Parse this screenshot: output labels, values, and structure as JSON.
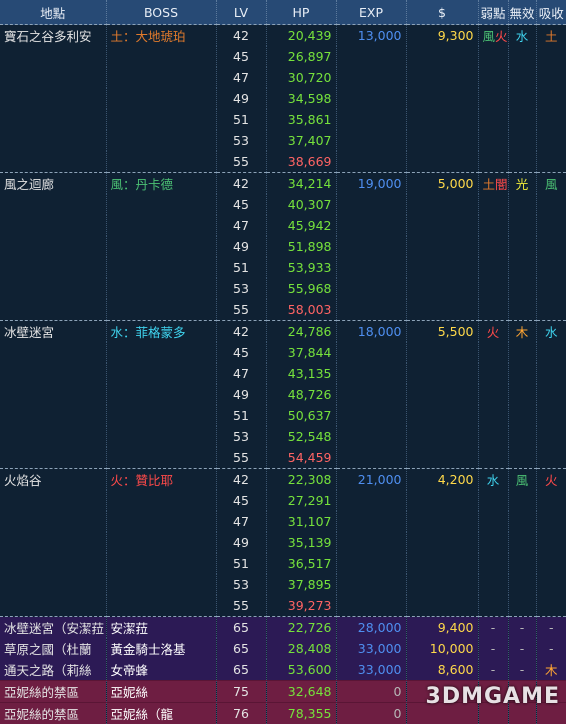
{
  "headers": [
    "地點",
    "BOSS",
    "LV",
    "HP",
    "EXP",
    "$",
    "弱點",
    "無效",
    "吸收"
  ],
  "colors": {
    "hp_green": "#76e23c",
    "hp_red": "#ff6464",
    "exp_blue": "#4f8ff0",
    "gold_yellow": "#ffd94a",
    "earth_orange": "#e07a2c",
    "wind_green": "#4cc274",
    "water_cyan": "#3fd3ee",
    "fire_red": "#ff4a4a",
    "light_yellow": "#f2ee3a",
    "wood_orange": "#ffa533",
    "earthdark_orange": "#e07a2c",
    "dash_gray": "#b7b7b7",
    "white": "#ffffff",
    "plain": "#e4e4e4"
  },
  "rows": [
    {
      "loc": "寶石之谷多利安",
      "boss": "土：大地琥珀",
      "boss_color": "earth_orange",
      "lv": "42",
      "hp": "20,439",
      "hp_color": "hp_green",
      "exp": "13,000",
      "gold": "9,300",
      "weak": "風火",
      "weak_colors": [
        "wind_green",
        "fire_red"
      ],
      "null": "水",
      "null_color": "water_cyan",
      "absorb": "土",
      "absorb_color": "earth_orange",
      "theme": "dark",
      "start": true
    },
    {
      "lv": "45",
      "hp": "26,897",
      "hp_color": "hp_green",
      "theme": "dark"
    },
    {
      "lv": "47",
      "hp": "30,720",
      "hp_color": "hp_green",
      "theme": "dark"
    },
    {
      "lv": "49",
      "hp": "34,598",
      "hp_color": "hp_green",
      "theme": "dark"
    },
    {
      "lv": "51",
      "hp": "35,861",
      "hp_color": "hp_green",
      "theme": "dark"
    },
    {
      "lv": "53",
      "hp": "37,407",
      "hp_color": "hp_green",
      "theme": "dark"
    },
    {
      "lv": "55",
      "hp": "38,669",
      "hp_color": "hp_red",
      "theme": "dark"
    },
    {
      "loc": "風之迴廊",
      "boss": "風：丹卡德",
      "boss_color": "wind_green",
      "lv": "42",
      "hp": "34,214",
      "hp_color": "hp_green",
      "exp": "19,000",
      "gold": "5,000",
      "weak": "土闇",
      "weak_colors": [
        "earth_orange",
        "fire_red"
      ],
      "null": "光",
      "null_color": "light_yellow",
      "absorb": "風",
      "absorb_color": "wind_green",
      "theme": "dark",
      "start": true
    },
    {
      "lv": "45",
      "hp": "40,307",
      "hp_color": "hp_green",
      "theme": "dark"
    },
    {
      "lv": "47",
      "hp": "45,942",
      "hp_color": "hp_green",
      "theme": "dark"
    },
    {
      "lv": "49",
      "hp": "51,898",
      "hp_color": "hp_green",
      "theme": "dark"
    },
    {
      "lv": "51",
      "hp": "53,933",
      "hp_color": "hp_green",
      "theme": "dark"
    },
    {
      "lv": "53",
      "hp": "55,968",
      "hp_color": "hp_green",
      "theme": "dark"
    },
    {
      "lv": "55",
      "hp": "58,003",
      "hp_color": "hp_red",
      "theme": "dark"
    },
    {
      "loc": "冰壁迷宮",
      "boss": "水：菲格蒙多",
      "boss_color": "water_cyan",
      "lv": "42",
      "hp": "24,786",
      "hp_color": "hp_green",
      "exp": "18,000",
      "gold": "5,500",
      "weak": "火",
      "weak_colors": [
        "fire_red"
      ],
      "null": "木",
      "null_color": "wood_orange",
      "absorb": "水",
      "absorb_color": "water_cyan",
      "theme": "dark",
      "start": true
    },
    {
      "lv": "45",
      "hp": "37,844",
      "hp_color": "hp_green",
      "theme": "dark"
    },
    {
      "lv": "47",
      "hp": "43,135",
      "hp_color": "hp_green",
      "theme": "dark"
    },
    {
      "lv": "49",
      "hp": "48,726",
      "hp_color": "hp_green",
      "theme": "dark"
    },
    {
      "lv": "51",
      "hp": "50,637",
      "hp_color": "hp_green",
      "theme": "dark"
    },
    {
      "lv": "53",
      "hp": "52,548",
      "hp_color": "hp_green",
      "theme": "dark"
    },
    {
      "lv": "55",
      "hp": "54,459",
      "hp_color": "hp_red",
      "theme": "dark"
    },
    {
      "loc": "火焰谷",
      "boss": "火：贊比耶",
      "boss_color": "fire_red",
      "lv": "42",
      "hp": "22,308",
      "hp_color": "hp_green",
      "exp": "21,000",
      "gold": "4,200",
      "weak": "水",
      "weak_colors": [
        "water_cyan"
      ],
      "null": "風",
      "null_color": "wind_green",
      "absorb": "火",
      "absorb_color": "fire_red",
      "theme": "dark",
      "start": true
    },
    {
      "lv": "45",
      "hp": "27,291",
      "hp_color": "hp_green",
      "theme": "dark"
    },
    {
      "lv": "47",
      "hp": "31,107",
      "hp_color": "hp_green",
      "theme": "dark"
    },
    {
      "lv": "49",
      "hp": "35,139",
      "hp_color": "hp_green",
      "theme": "dark"
    },
    {
      "lv": "51",
      "hp": "36,517",
      "hp_color": "hp_green",
      "theme": "dark"
    },
    {
      "lv": "53",
      "hp": "37,895",
      "hp_color": "hp_green",
      "theme": "dark"
    },
    {
      "lv": "55",
      "hp": "39,273",
      "hp_color": "hp_red",
      "theme": "dark"
    },
    {
      "loc": "冰壁迷宮（安潔菈",
      "boss": "安潔菈",
      "boss_color": "white",
      "lv": "65",
      "hp": "22,726",
      "hp_color": "hp_green",
      "exp": "28,000",
      "gold": "9,400",
      "weak": "-",
      "weak_colors": [
        "dash_gray"
      ],
      "null": "-",
      "null_color": "dash_gray",
      "absorb": "-",
      "absorb_color": "dash_gray",
      "theme": "purple",
      "start": true
    },
    {
      "loc": "草原之國（杜蘭",
      "boss": "黃金騎士洛基",
      "boss_color": "white",
      "lv": "65",
      "hp": "28,408",
      "hp_color": "hp_green",
      "exp": "33,000",
      "gold": "10,000",
      "weak": "-",
      "weak_colors": [
        "dash_gray"
      ],
      "null": "-",
      "null_color": "dash_gray",
      "absorb": "-",
      "absorb_color": "dash_gray",
      "theme": "purple"
    },
    {
      "loc": "通天之路（莉絲",
      "boss": "女帝蜂",
      "boss_color": "white",
      "lv": "65",
      "hp": "53,600",
      "hp_color": "hp_green",
      "exp": "33,000",
      "gold": "8,600",
      "weak": "-",
      "weak_colors": [
        "dash_gray"
      ],
      "null": "-",
      "null_color": "dash_gray",
      "absorb": "木",
      "absorb_color": "wood_orange",
      "theme": "purple"
    },
    {
      "loc": "亞妮絲的禁區",
      "boss": "亞妮絲",
      "boss_color": "white",
      "lv": "75",
      "hp": "32,648",
      "hp_color": "hp_green",
      "exp": "0",
      "gold": "",
      "weak": "",
      "weak_colors": [],
      "null": "",
      "null_color": "dash_gray",
      "absorb": "",
      "absorb_color": "dash_gray",
      "theme": "red",
      "start": true
    },
    {
      "loc": "亞妮絲的禁區",
      "boss": "亞妮絲（龍",
      "boss_color": "white",
      "lv": "76",
      "hp": "78,355",
      "hp_color": "hp_green",
      "exp": "0",
      "gold": "",
      "weak": "",
      "weak_colors": [],
      "null": "",
      "null_color": "dash_gray",
      "absorb": "",
      "absorb_color": "dash_gray",
      "theme": "red"
    }
  ],
  "watermark": "3DMGAME"
}
